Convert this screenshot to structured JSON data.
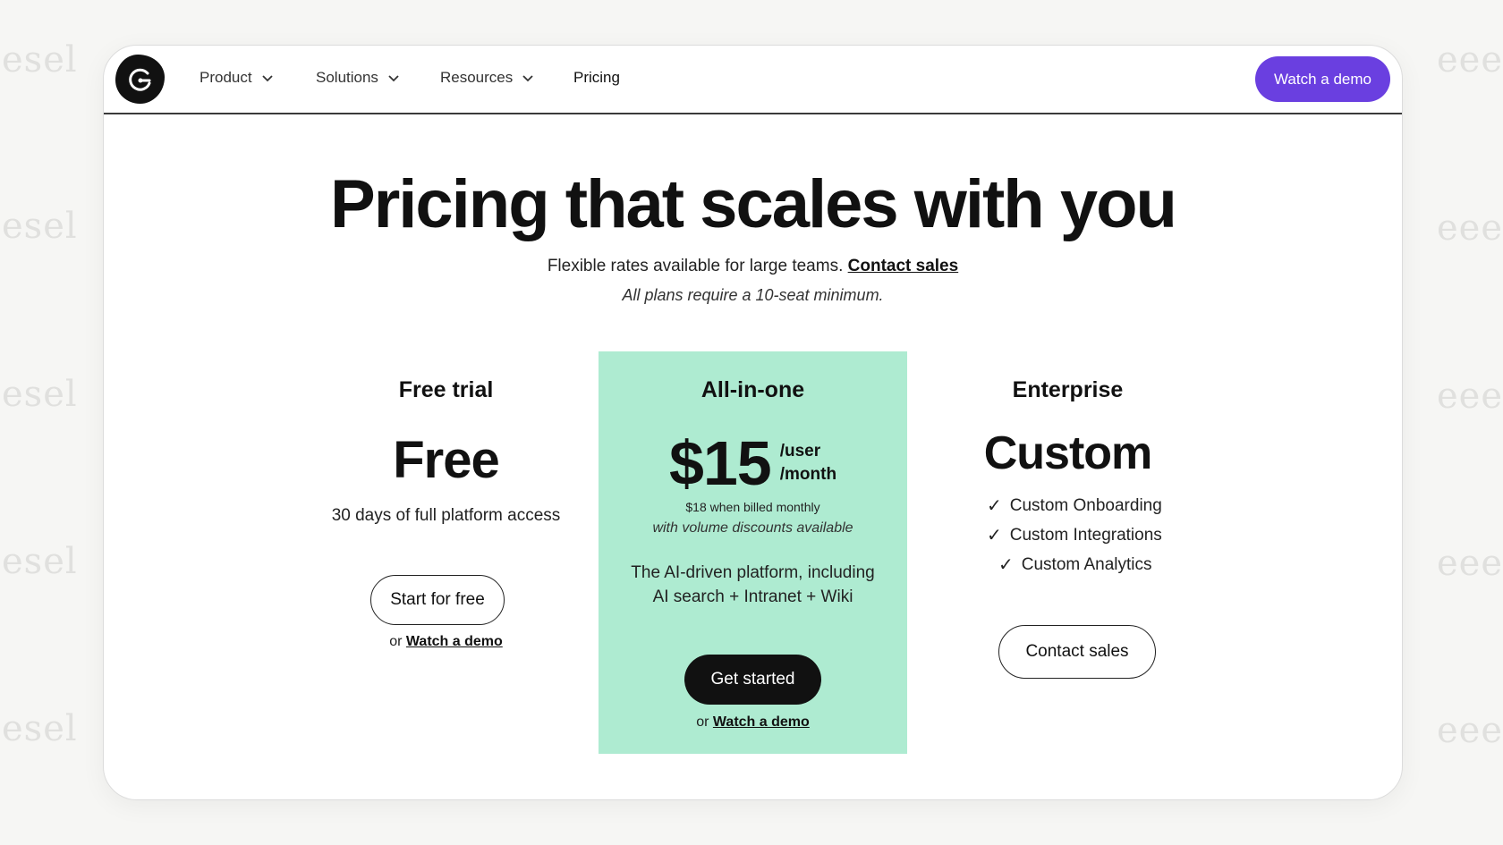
{
  "watermark": "esel",
  "nav": {
    "items": [
      {
        "label": "Product",
        "dropdown": true
      },
      {
        "label": "Solutions",
        "dropdown": true
      },
      {
        "label": "Resources",
        "dropdown": true
      },
      {
        "label": "Pricing",
        "dropdown": false
      }
    ],
    "cta_label": "Watch a demo",
    "cta_color": "#6a3fe0"
  },
  "hero": {
    "title": "Pricing that scales with you",
    "subtitle": "Flexible rates available for large teams.",
    "subtitle_link": "Contact sales",
    "note": "All plans require a 10-seat minimum."
  },
  "plans": {
    "free": {
      "name": "Free trial",
      "price": "Free",
      "description": "30 days of full platform access",
      "button": "Start for free",
      "or_text": "or",
      "or_link": "Watch a demo"
    },
    "aio": {
      "name": "All-in-one",
      "price": "$15",
      "unit_user": "/user",
      "unit_month": "/month",
      "billing_note": "$18 when billed monthly",
      "discount_note": "with volume discounts available",
      "description_line1": "The AI-driven platform, including",
      "description_line2": "AI search + Intranet + Wiki",
      "button": "Get started",
      "or_text": "or",
      "or_link": "Watch a demo",
      "highlight_color": "#aeebd1"
    },
    "enterprise": {
      "name": "Enterprise",
      "price": "Custom",
      "features": [
        "Custom Onboarding",
        "Custom Integrations",
        "Custom Analytics"
      ],
      "button": "Contact sales"
    }
  }
}
